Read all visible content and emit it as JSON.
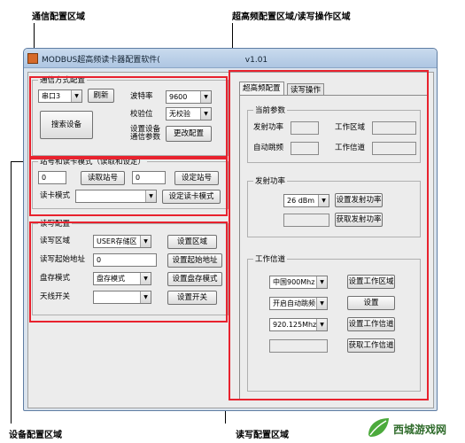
{
  "annotations": {
    "comm": "通信配置区域",
    "uhf": "超高频配置区域/读写操作区域",
    "device": "设备配置区域",
    "rw": "读写配置区域"
  },
  "window": {
    "title": "MODBUS超高频读卡器配置软件(",
    "version": "v1.01"
  },
  "comm": {
    "title": "通信方式配置",
    "port_value": "串口3",
    "refresh_label": "刷新",
    "baud_label": "波特率",
    "baud_value": "9600",
    "parity_label": "校验位",
    "parity_value": "无校验",
    "search_label": "搜索设备",
    "set_comm_label": "设置设备\n通信参数",
    "change_label": "更改配置"
  },
  "station": {
    "title": "站号和读卡模式（读取和设定）",
    "read_value": "0",
    "read_label": "读取站号",
    "set_value": "0",
    "set_label": "设定站号",
    "mode_label": "读卡模式",
    "mode_value": "",
    "set_mode_label": "设定读卡模式"
  },
  "rw_config": {
    "title": "读写配置",
    "area_label": "读写区域",
    "area_value": "USER存储区",
    "set_area_label": "设置区域",
    "addr_label": "读写起始地址",
    "addr_value": "0",
    "set_addr_label": "设置起始地址",
    "store_label": "盘存模式",
    "store_value": "盘存模式",
    "set_store_label": "设置盘存模式",
    "antenna_label": "天线开关",
    "antenna_value": "",
    "set_antenna_label": "设置开关"
  },
  "tabs": {
    "uhf": "超高频配置",
    "rw": "读写操作"
  },
  "current": {
    "title": "当前参数",
    "power_label": "发射功率",
    "area_label": "工作区域",
    "hop_label": "自动跳频",
    "channel_label": "工作信道"
  },
  "power": {
    "title": "发射功率",
    "value": "26 dBm",
    "set_label": "设置发射功率",
    "get_label": "获取发射功率"
  },
  "channel": {
    "title": "工作信道",
    "region_value": "中国900Mhz",
    "set_region_label": "设置工作区域",
    "hop_value": "开启自动跳频",
    "set_label": "设置",
    "freq_value": "920.125Mhz",
    "set_channel_label": "设置工作信道",
    "get_channel_label": "获取工作信道"
  },
  "watermark": "西城游戏网",
  "colors": {
    "highlight": "#e8222e",
    "titlebar": "#aec6e2",
    "client": "#ececec"
  }
}
